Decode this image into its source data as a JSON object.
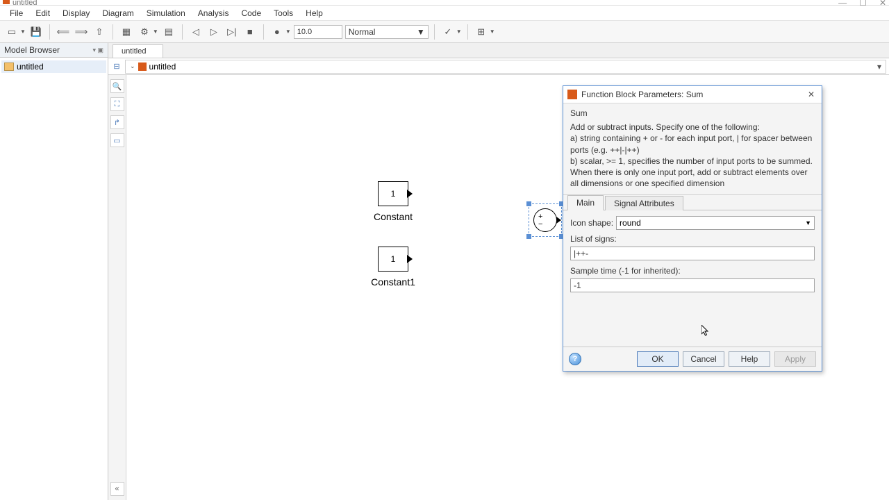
{
  "window": {
    "title": "untitled"
  },
  "win_controls": {
    "min": "—",
    "max": "☐",
    "close": "✕"
  },
  "menubar": [
    "File",
    "Edit",
    "Display",
    "Diagram",
    "Simulation",
    "Analysis",
    "Code",
    "Tools",
    "Help"
  ],
  "toolbar": {
    "stop_time": "10.0",
    "mode": "Normal"
  },
  "model_browser": {
    "title": "Model Browser",
    "root": "untitled"
  },
  "doc_tab": "untitled",
  "breadcrumb": "untitled",
  "blocks": {
    "constant": {
      "value": "1",
      "label": "Constant"
    },
    "constant1": {
      "value": "1",
      "label": "Constant1"
    },
    "sum_sign_top": "+",
    "sum_sign_bottom": "−"
  },
  "dialog": {
    "title": "Function Block Parameters: Sum",
    "block_name": "Sum",
    "desc_l1": "Add or subtract inputs.  Specify one of the following:",
    "desc_l2": "a) string containing + or - for each input port, | for spacer between ports (e.g. ++|-|++)",
    "desc_l3": "b) scalar, >= 1, specifies the number of input ports to be summed.",
    "desc_l4": "When there is only one input port, add or subtract elements over all dimensions or one specified dimension",
    "tabs": {
      "main": "Main",
      "sig": "Signal Attributes"
    },
    "icon_shape_label": "Icon shape:",
    "icon_shape_value": "round",
    "list_of_signs_label": "List of signs:",
    "list_of_signs_value": "|++-",
    "sample_time_label": "Sample time (-1 for inherited):",
    "sample_time_value": "-1",
    "buttons": {
      "ok": "OK",
      "cancel": "Cancel",
      "help": "Help",
      "apply": "Apply"
    }
  }
}
